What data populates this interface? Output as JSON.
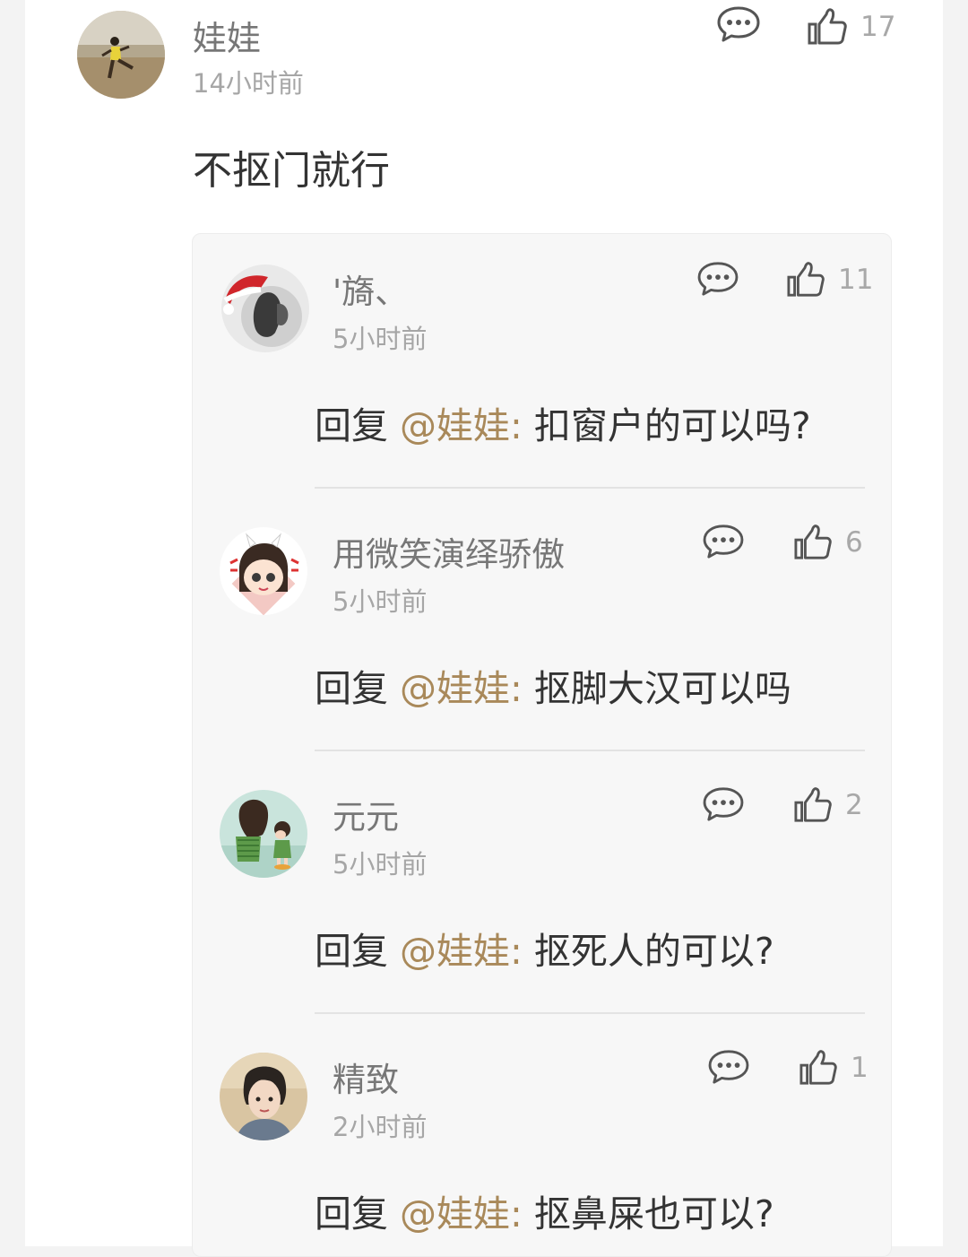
{
  "main_comment": {
    "author": "娃娃",
    "time": "14小时前",
    "text": "不抠门就行",
    "likes": "17",
    "avatar_icon": "avatar-girl-beach"
  },
  "replies": [
    {
      "author": "'旖、",
      "time": "5小时前",
      "reply_label": "回复",
      "mention": "@娃娃:",
      "text": "扣窗户的可以吗?",
      "likes": "11",
      "avatar_icon": "avatar-christmas-hat"
    },
    {
      "author": "用微笑演绎骄傲",
      "time": "5小时前",
      "reply_label": "回复",
      "mention": "@娃娃:",
      "text": "抠脚大汉可以吗",
      "likes": "6",
      "avatar_icon": "avatar-cartoon-girl"
    },
    {
      "author": "元元",
      "time": "5小时前",
      "reply_label": "回复",
      "mention": "@娃娃:",
      "text": "抠死人的可以?",
      "likes": "2",
      "avatar_icon": "avatar-cartoon-couple"
    },
    {
      "author": "精致",
      "time": "2小时前",
      "reply_label": "回复",
      "mention": "@娃娃:",
      "text": "抠鼻屎也可以?",
      "likes": "1",
      "avatar_icon": "avatar-short-hair"
    }
  ],
  "colors": {
    "mention": "#a9895a",
    "name": "#777777",
    "time": "#a6a6a6",
    "text": "#333333",
    "icon": "#555555"
  }
}
